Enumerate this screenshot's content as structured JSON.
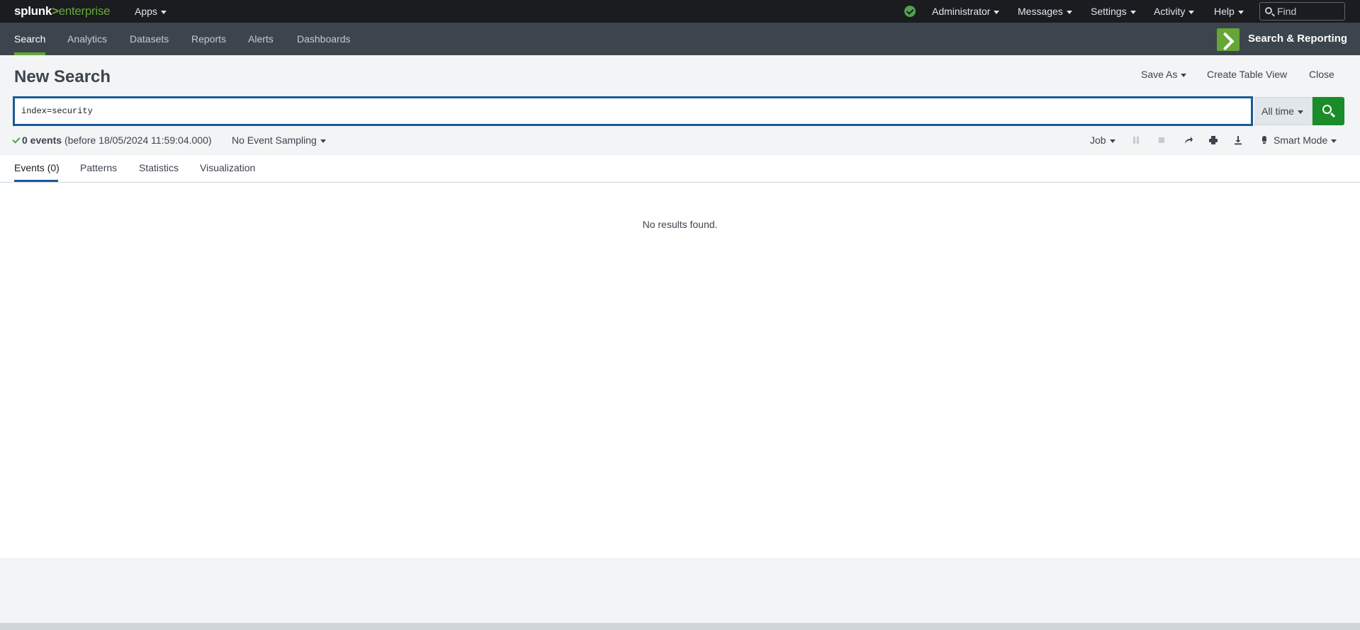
{
  "topbar": {
    "logo_brand": "splunk",
    "logo_product": "enterprise",
    "apps_label": "Apps",
    "user_label": "Administrator",
    "messages_label": "Messages",
    "settings_label": "Settings",
    "activity_label": "Activity",
    "help_label": "Help",
    "find_placeholder": "Find",
    "status_color": "#53a051"
  },
  "appbar": {
    "nav": [
      "Search",
      "Analytics",
      "Datasets",
      "Reports",
      "Alerts",
      "Dashboards"
    ],
    "active_nav": "Search",
    "app_title": "Search & Reporting",
    "accent": "#65a637"
  },
  "page": {
    "title": "New Search",
    "save_as": "Save As",
    "create_table_view": "Create Table View",
    "close": "Close"
  },
  "search": {
    "query": "index=security",
    "time_range": "All time",
    "button_color": "#1a8c29"
  },
  "status": {
    "events_count": "0 events",
    "events_detail": "(before 18/05/2024 11:59:04.000)",
    "sampling": "No Event Sampling",
    "job": "Job",
    "mode": "Smart Mode"
  },
  "tabs": [
    "Events (0)",
    "Patterns",
    "Statistics",
    "Visualization"
  ],
  "active_tab": "Events (0)",
  "results": {
    "message": "No results found."
  }
}
